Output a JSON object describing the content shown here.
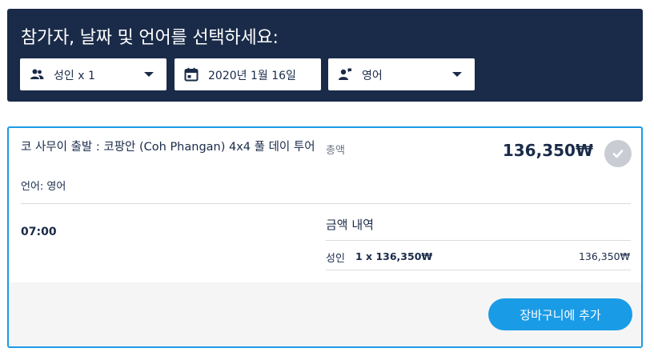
{
  "header": {
    "title": "참가자, 날짜 및 언어를 선택하세요:",
    "participants": {
      "value": "성인 x 1",
      "icon": "people-icon"
    },
    "date": {
      "value": "2020년 1월 16일",
      "icon": "calendar-icon"
    },
    "language": {
      "value": "영어",
      "icon": "guide-person-icon"
    }
  },
  "option": {
    "title": "코 사무이 출발 : 코팡안 (Coh Phangan) 4x4 풀 데이 투어",
    "language_line": "언어: 영어",
    "total_label": "총액",
    "total_price": "136,350₩",
    "time": "07:00",
    "breakdown": {
      "title": "금액 내역",
      "rows": [
        {
          "label": "성인",
          "calc": "1 x 136,350₩",
          "amount": "136,350₩"
        }
      ]
    },
    "cart_button_label": "장바구니에 추가"
  },
  "colors": {
    "header_bg": "#1a2b49",
    "accent": "#1a9be6",
    "selected_check": "#c9ccd3"
  }
}
